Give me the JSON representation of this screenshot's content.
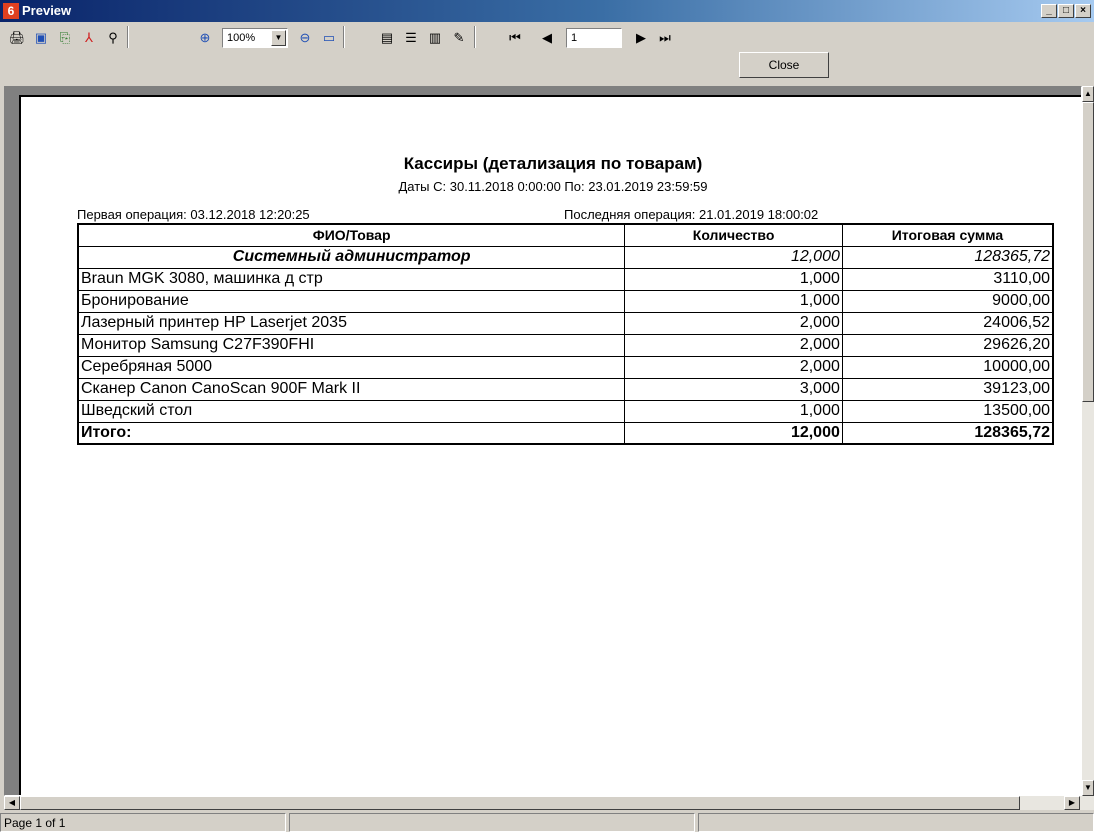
{
  "window": {
    "app_icon_text": "6",
    "title": "Preview"
  },
  "toolbar": {
    "icons": [
      "print-icon",
      "save-icon",
      "export-icon",
      "pdf-icon",
      "find-icon",
      "zoom-in-icon",
      "zoom-out-icon",
      "fit-page-icon",
      "page-setup-icon",
      "outline-icon",
      "book-icon",
      "edit-icon",
      "first-page-icon",
      "prev-page-icon",
      "next-page-icon",
      "last-page-icon"
    ],
    "zoom_value": "100%",
    "page_value": "1",
    "close_label": "Close"
  },
  "report": {
    "title": "Кассиры (детализация по товарам)",
    "dates": "Даты С: 30.11.2018 0:00:00 По: 23.01.2019 23:59:59",
    "first_operation": "Первая операция: 03.12.2018 12:20:25",
    "last_operation": "Последняя операция: 21.01.2019 18:00:02",
    "columns": [
      "ФИО/Товар",
      "Количество",
      "Итоговая сумма"
    ],
    "group": {
      "name": "Системный администратор",
      "qty": "12,000",
      "sum": "128365,72"
    },
    "rows": [
      {
        "name": "Braun MGK 3080, машинка д стр",
        "qty": "1,000",
        "sum": "3110,00"
      },
      {
        "name": "Бронирование",
        "qty": "1,000",
        "sum": "9000,00"
      },
      {
        "name": "Лазерный принтер HP Laserjet 2035",
        "qty": "2,000",
        "sum": "24006,52"
      },
      {
        "name": "Монитор Samsung C27F390FHI",
        "qty": "2,000",
        "sum": "29626,20"
      },
      {
        "name": "Серебряная 5000",
        "qty": "2,000",
        "sum": "10000,00"
      },
      {
        "name": "Сканер Canon CanoScan 900F Mark II",
        "qty": "3,000",
        "sum": "39123,00"
      },
      {
        "name": "Шведский стол",
        "qty": "1,000",
        "sum": "13500,00"
      }
    ],
    "total": {
      "label": "Итого:",
      "qty": "12,000",
      "sum": "128365,72"
    }
  },
  "statusbar": {
    "page_info": "Page 1 of 1"
  }
}
